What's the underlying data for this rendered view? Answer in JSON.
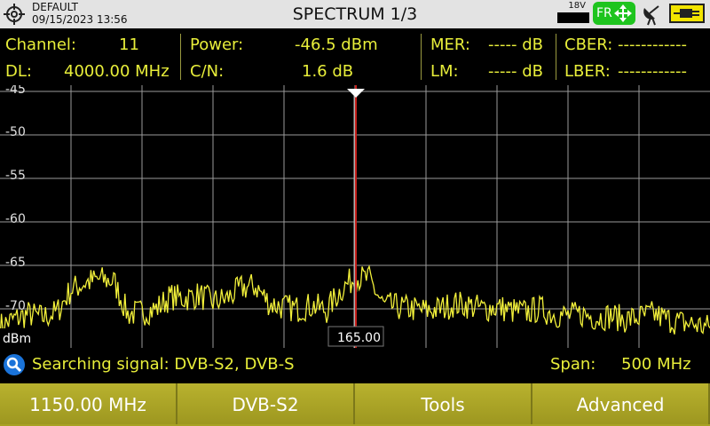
{
  "header": {
    "profile": "DEFAULT",
    "datetime": "09/15/2023 13:56",
    "title": "SPECTRUM 1/3",
    "lnb_voltage": "18V",
    "region_badge": "FR",
    "icons": [
      "target-icon",
      "move-arrows-icon",
      "satellite-dish-icon",
      "power-plug-icon"
    ]
  },
  "measurements": {
    "channel_label": "Channel:",
    "channel_value": "11",
    "dl_label": "DL:",
    "dl_value": "4000.00 MHz",
    "power_label": "Power:",
    "power_value": "-46.5 dBm",
    "cn_label": "C/N:",
    "cn_value": "1.6 dB",
    "mer_label": "MER:",
    "mer_value": "----- dB",
    "lm_label": "LM:",
    "lm_value": "----- dB",
    "cber_label": "CBER:",
    "cber_value": "------------",
    "lber_label": "LBER:",
    "lber_value": "------------"
  },
  "spectrum": {
    "y_ticks": [
      "-45",
      "-50",
      "-55",
      "-60",
      "-65",
      "-70"
    ],
    "unit": "dBm",
    "marker_readout": "165.00",
    "colors": {
      "trace": "#f2f03a",
      "marker": "#c8201c",
      "grid": "#9a9a9a",
      "text": "#ffffff"
    }
  },
  "chart_data": {
    "type": "line",
    "ylabel": "dBm",
    "ylim": [
      -75,
      -45
    ],
    "x_marker_mhz": 1150,
    "span_mhz": 500,
    "x_range_mhz": [
      900,
      1400
    ],
    "series": [
      {
        "x": [
          900,
          910,
          920,
          930,
          940,
          950,
          960,
          970,
          980,
          990,
          1000,
          1010,
          1020,
          1030,
          1040,
          1050,
          1060,
          1070,
          1080,
          1090,
          1100,
          1110,
          1120,
          1130,
          1140,
          1150,
          1160,
          1170,
          1180,
          1190,
          1200,
          1210,
          1220,
          1230,
          1240,
          1250,
          1260,
          1270,
          1280,
          1290,
          1300,
          1310,
          1320,
          1330,
          1340,
          1350,
          1360,
          1370,
          1380,
          1390,
          1400
        ],
        "values": [
          -72.0,
          -71.2,
          -70.6,
          -71.0,
          -70.4,
          -67.8,
          -67.0,
          -66.6,
          -66.8,
          -70.6,
          -70.4,
          -70.0,
          -68.6,
          -68.8,
          -68.4,
          -69.2,
          -68.8,
          -67.6,
          -67.4,
          -69.4,
          -69.8,
          -70.0,
          -69.6,
          -70.2,
          -67.8,
          -66.4,
          -66.6,
          -69.6,
          -69.8,
          -70.0,
          -70.2,
          -70.0,
          -69.4,
          -69.6,
          -70.0,
          -69.8,
          -70.2,
          -70.4,
          -70.0,
          -70.6,
          -70.8,
          -70.6,
          -71.0,
          -70.8,
          -71.2,
          -71.0,
          -70.6,
          -71.2,
          -71.6,
          -71.8,
          -72.2
        ]
      }
    ]
  },
  "status": {
    "message": "Searching signal: DVB-S2, DVB-S",
    "span_label": "Span:",
    "span_value": "500 MHz"
  },
  "softkeys": [
    "1150.00 MHz",
    "DVB-S2",
    "Tools",
    "Advanced"
  ]
}
